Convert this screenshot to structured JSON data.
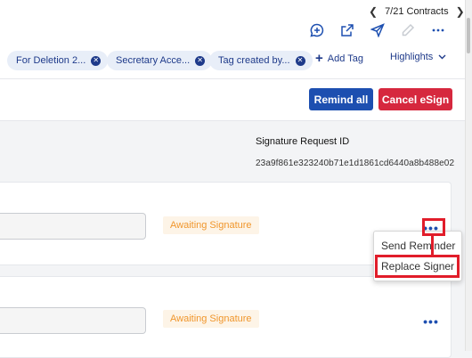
{
  "pager": {
    "label": "7/21 Contracts"
  },
  "actions": {
    "icons": [
      "chat-plus-icon",
      "external-link-icon",
      "send-icon",
      "pencil-icon",
      "more-icon"
    ]
  },
  "tags": [
    {
      "label": "For Deletion 2..."
    },
    {
      "label": "Secretary Acce..."
    },
    {
      "label": "Tag created by..."
    }
  ],
  "tagbar": {
    "add_tag": "Add Tag",
    "highlights": "Highlights"
  },
  "buttons": {
    "remind_all": "Remind all",
    "cancel_esign": "Cancel eSign"
  },
  "signature": {
    "label": "Signature Request ID",
    "value": "23a9f861e323240b71e1d1861cd6440a8b488e02"
  },
  "signers": [
    {
      "status": "Awaiting Signature"
    },
    {
      "status": "Awaiting Signature"
    }
  ],
  "menu": {
    "items": [
      "Send Reminder",
      "Replace Signer"
    ]
  },
  "colors": {
    "primary": "#1d4fb0",
    "danger": "#d6283e",
    "highlight": "#e11d2a",
    "status": "#f0962c"
  }
}
